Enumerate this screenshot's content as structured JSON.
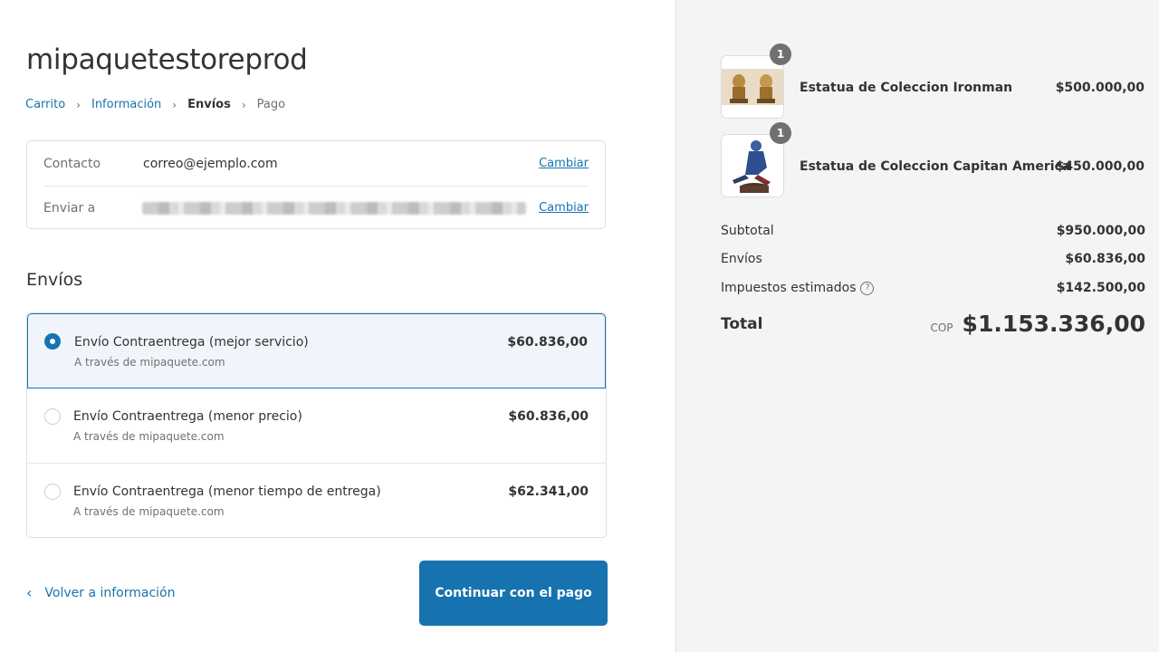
{
  "store": {
    "name": "mipaquetestoreprod"
  },
  "breadcrumb": {
    "items": [
      {
        "label": "Carrito",
        "state": "link"
      },
      {
        "label": "Información",
        "state": "link"
      },
      {
        "label": "Envíos",
        "state": "current"
      },
      {
        "label": "Pago",
        "state": "future"
      }
    ]
  },
  "info": {
    "contact_label": "Contacto",
    "contact_value": "correo@ejemplo.com",
    "shipto_label": "Enviar a",
    "change_label": "Cambiar"
  },
  "shipping": {
    "title": "Envíos",
    "options": [
      {
        "name": "Envío Contraentrega (mejor servicio)",
        "via": "A través de mipaquete.com",
        "price": "$60.836,00",
        "selected": true
      },
      {
        "name": "Envío Contraentrega (menor precio)",
        "via": "A través de mipaquete.com",
        "price": "$60.836,00",
        "selected": false
      },
      {
        "name": "Envío Contraentrega (menor tiempo de entrega)",
        "via": "A través de mipaquete.com",
        "price": "$62.341,00",
        "selected": false
      }
    ]
  },
  "nav": {
    "back_label": "Volver a información",
    "continue_label": "Continuar con el pago"
  },
  "order": {
    "items": [
      {
        "name": "Estatua de Coleccion Ironman",
        "price": "$500.000,00",
        "qty": "1"
      },
      {
        "name": "Estatua de Coleccion Capitan America",
        "price": "$450.000,00",
        "qty": "1"
      }
    ],
    "subtotal_label": "Subtotal",
    "subtotal": "$950.000,00",
    "shipping_label": "Envíos",
    "shipping": "$60.836,00",
    "taxes_label": "Impuestos estimados",
    "taxes": "$142.500,00",
    "total_label": "Total",
    "currency": "COP",
    "total": "$1.153.336,00"
  },
  "colors": {
    "accent": "#1773b0",
    "sidebar_bg": "#f4f4f4",
    "selected_bg": "#f0f5fb"
  }
}
